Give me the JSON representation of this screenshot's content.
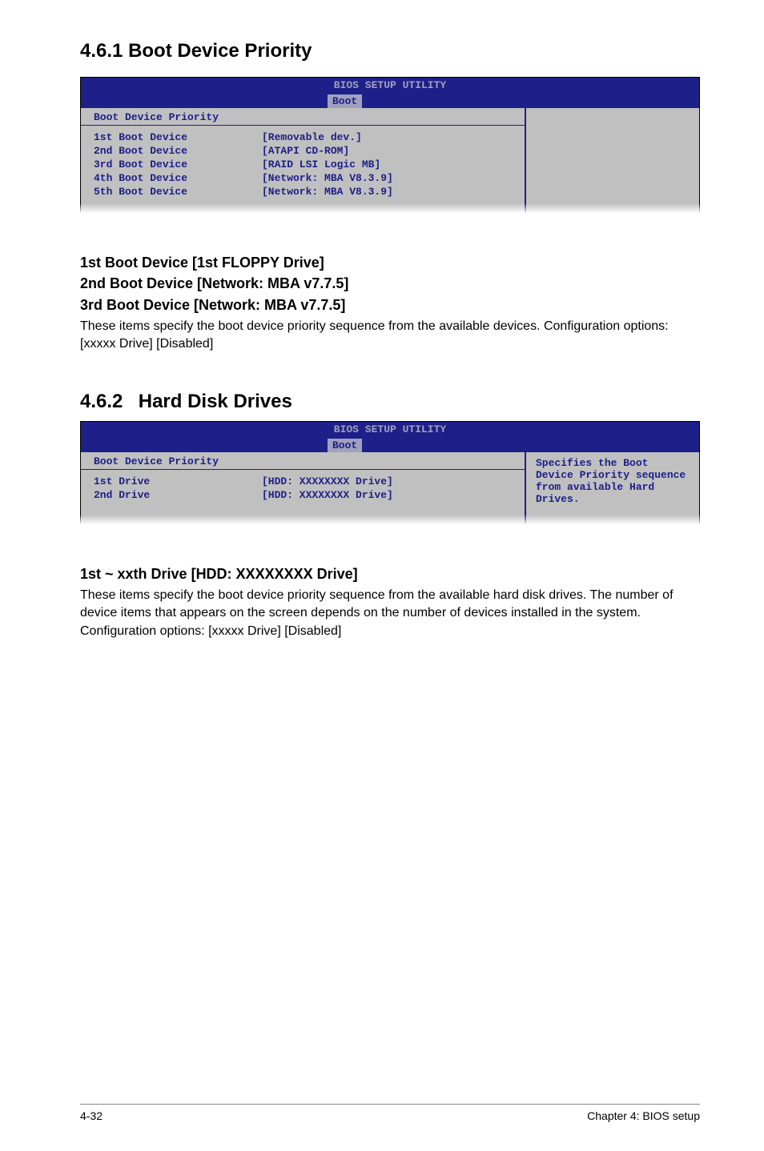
{
  "section1": {
    "number": "4.6.1",
    "title": "Boot Device Priority"
  },
  "bios1": {
    "title": "BIOS SETUP UTILITY",
    "tab": "Boot",
    "panel_heading": "Boot Device Priority",
    "rows": [
      {
        "label": "1st Boot Device",
        "value": "[Removable dev.]"
      },
      {
        "label": "2nd Boot Device",
        "value": "[ATAPI CD-ROM]"
      },
      {
        "label": "3rd Boot Device",
        "value": "[RAID LSI Logic MB]"
      },
      {
        "label": "4th Boot Device",
        "value": "[Network: MBA V8.3.9]"
      },
      {
        "label": "5th Boot Device",
        "value": "[Network: MBA V8.3.9]"
      }
    ]
  },
  "para1": {
    "h1": "1st Boot Device [1st FLOPPY Drive]",
    "h2": "2nd Boot Device [Network: MBA v7.7.5]",
    "h3": "3rd Boot Device [Network: MBA v7.7.5]",
    "body": "These items specify the boot device priority sequence from the available devices. Configuration options: [xxxxx Drive] [Disabled]"
  },
  "section2": {
    "number": "4.6.2",
    "title": "Hard Disk Drives"
  },
  "bios2": {
    "title": "BIOS SETUP UTILITY",
    "tab": "Boot",
    "panel_heading": "Boot Device Priority",
    "rows": [
      {
        "label": "1st Drive",
        "value": "[HDD: XXXXXXXX Drive]"
      },
      {
        "label": "2nd Drive",
        "value": "[HDD: XXXXXXXX Drive]"
      }
    ],
    "help_text": "Specifies the Boot Device Priority sequence from available Hard Drives."
  },
  "para2": {
    "h1": "1st ~ xxth Drive [HDD: XXXXXXXX Drive]",
    "body": "These items specify the boot device priority sequence from the available hard disk drives. The number of device items that appears on the screen depends on the number of devices installed in the system. Configuration options: [xxxxx Drive] [Disabled]"
  },
  "footer": {
    "left": "4-32",
    "right": "Chapter 4: BIOS setup"
  }
}
